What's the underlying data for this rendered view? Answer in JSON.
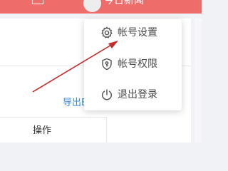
{
  "header": {
    "username": "今日新闻",
    "top_icon": "window-icon",
    "bg_color": "#ee6c69"
  },
  "main": {
    "export_label": "导出EXCEL",
    "table_header": "操作"
  },
  "dropdown": {
    "items": [
      {
        "label": "帐号设置",
        "icon": "gear-icon"
      },
      {
        "label": "帐号权限",
        "icon": "shield-icon"
      },
      {
        "label": "退出登录",
        "icon": "power-icon"
      }
    ]
  },
  "annotation": {
    "color": "#c62a2a"
  }
}
